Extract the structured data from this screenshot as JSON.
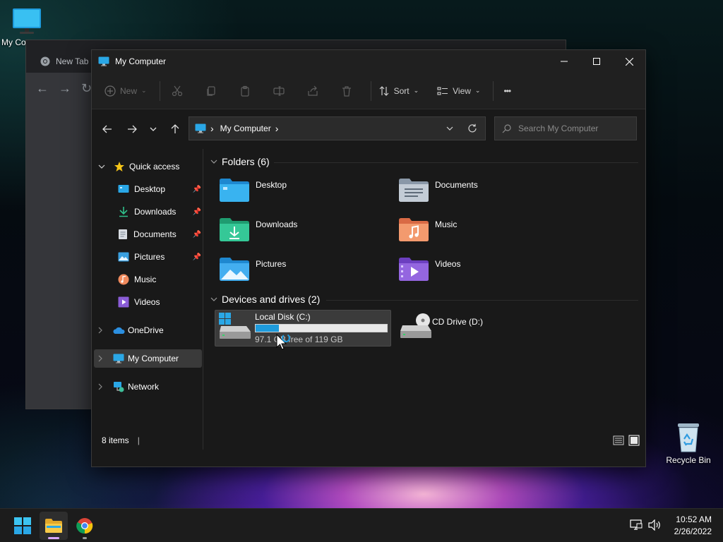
{
  "desktop": {
    "icons": [
      {
        "label": "My Co"
      },
      {
        "label": "Recycle Bin"
      }
    ]
  },
  "chrome": {
    "tab_title": "New Tab"
  },
  "explorer": {
    "title": "My Computer",
    "toolbar": {
      "new_label": "New",
      "sort_label": "Sort",
      "view_label": "View",
      "more_label": "•••"
    },
    "address": {
      "separator": "›",
      "crumb": "My Computer",
      "crumb_arrow": "›"
    },
    "search": {
      "placeholder": "Search My Computer"
    },
    "sidebar": {
      "quick_access": "Quick access",
      "pinned": [
        {
          "label": "Desktop"
        },
        {
          "label": "Downloads"
        },
        {
          "label": "Documents"
        },
        {
          "label": "Pictures"
        }
      ],
      "others": [
        {
          "label": "Music"
        },
        {
          "label": "Videos"
        }
      ],
      "onedrive": "OneDrive",
      "my_computer": "My Computer",
      "network": "Network"
    },
    "folders_header": "Folders (6)",
    "folders": [
      {
        "label": "Desktop"
      },
      {
        "label": "Documents"
      },
      {
        "label": "Downloads"
      },
      {
        "label": "Music"
      },
      {
        "label": "Pictures"
      },
      {
        "label": "Videos"
      }
    ],
    "drives_header": "Devices and drives (2)",
    "drives": [
      {
        "label": "Local Disk (C:)",
        "free_text": "97.1 GB free of 119 GB",
        "used_fraction": 0.18
      },
      {
        "label": "CD Drive (D:)"
      }
    ],
    "status": {
      "items_text": "8 items",
      "cursor": "|"
    }
  },
  "taskbar": {
    "time": "10:52 AM",
    "date": "2/26/2022"
  },
  "colors": {
    "accent": "#1e9bdc",
    "folder_blue": "#3aa0e0",
    "folder_green": "#2fbf8a",
    "folder_orange": "#f08a5d",
    "folder_purple": "#8a5cd6"
  }
}
